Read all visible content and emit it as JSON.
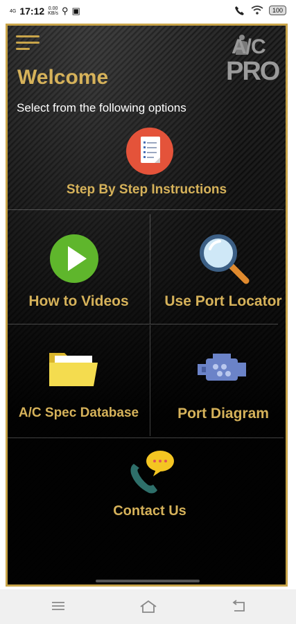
{
  "status_bar": {
    "network": "4G",
    "time": "17:12",
    "speed_value": "0.00",
    "speed_unit": "KB/s",
    "battery": "100"
  },
  "header": {
    "welcome": "Welcome",
    "subtitle": "Select from the following options",
    "logo_top": "A/C",
    "logo_bottom": "PRO"
  },
  "menu": {
    "step_by_step": "Step By Step Instructions",
    "how_to_videos": "How to Videos",
    "use_port_locator": "Use Port Locator",
    "ac_spec_database": "A/C Spec Database",
    "port_diagram": "Port Diagram",
    "contact_us": "Contact Us"
  },
  "colors": {
    "gold": "#d6b25a",
    "border": "#c9a54a",
    "icon_red": "#e4533a",
    "icon_green": "#5fb62c",
    "folder_yellow": "#f4dc4f",
    "engine_blue": "#6b83c8"
  }
}
